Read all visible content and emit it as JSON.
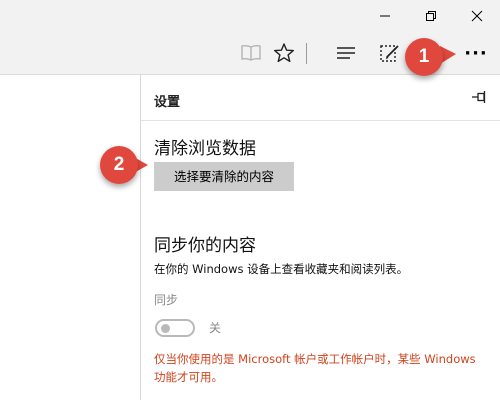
{
  "window_controls": {
    "minimize_icon": "minimize-icon",
    "restore_icon": "restore-icon",
    "close_icon": "close-icon"
  },
  "toolbar": {
    "icons": [
      "reading-view-icon",
      "favorites-star-icon",
      "hub-icon",
      "web-note-icon",
      "more-icon"
    ],
    "more_label": "···"
  },
  "settings": {
    "title": "设置",
    "pin_icon": "pin-icon",
    "clear_section": {
      "heading": "清除浏览数据",
      "button_label": "选择要清除的内容"
    },
    "sync_section": {
      "heading": "同步你的内容",
      "description": "在你的 Windows 设备上查看收藏夹和阅读列表。",
      "label": "同步",
      "toggle_state": "关",
      "toggle_on": false,
      "warning": "仅当你使用的是 Microsoft 帐户或工作帐户时，某些 Windows 功能才可用。"
    }
  },
  "callouts": [
    {
      "number": "1"
    },
    {
      "number": "2"
    }
  ],
  "colors": {
    "callout": "#e0483e",
    "warning": "#d0431c",
    "button_bg": "#cccccc"
  }
}
